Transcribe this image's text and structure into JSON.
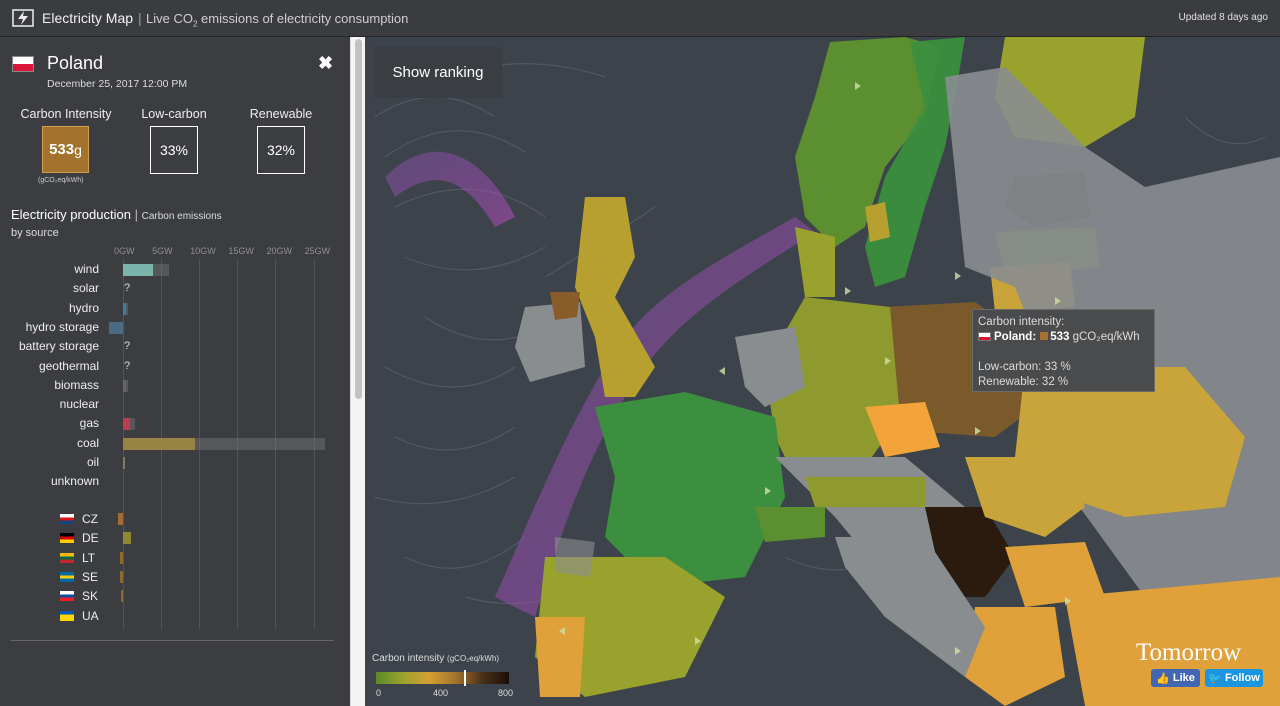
{
  "header": {
    "app_name": "Electricity Map",
    "separator": "|",
    "subtitle_prefix": "Live CO",
    "subtitle_sub": "2",
    "subtitle_suffix": " emissions of electricity consumption",
    "updated": "Updated 8 days ago"
  },
  "panel": {
    "country": "Poland",
    "datetime": "December 25, 2017 12:00 PM",
    "close_symbol": "✖",
    "carbon_intensity": {
      "label": "Carbon Intensity",
      "value": "533",
      "unit_suffix": "g",
      "unit_note": "(gCO₂eq/kWh)",
      "color": "#a3732e"
    },
    "low_carbon": {
      "label": "Low-carbon",
      "value": "33%"
    },
    "renewable": {
      "label": "Renewable",
      "value": "32%"
    },
    "production": {
      "title": "Electricity production",
      "separator": "|",
      "alt_tab": "Carbon emissions",
      "subtitle": "by source",
      "axis_ticks": [
        "0GW",
        "5GW",
        "10GW",
        "15GW",
        "20GW",
        "25GW"
      ],
      "axis_max_gw": 26.5,
      "sources": [
        {
          "label": "wind",
          "value_gw": 4.0,
          "capacity_gw": 6.0,
          "color": "#80bfb2",
          "unknown": false
        },
        {
          "label": "solar",
          "value_gw": null,
          "capacity_gw": null,
          "color": "#f2c94c",
          "unknown": true,
          "unknown_mark": "?"
        },
        {
          "label": "hydro",
          "value_gw": 0.35,
          "capacity_gw": 0.6,
          "color": "#3b7fb3",
          "unknown": false
        },
        {
          "label": "hydro storage",
          "value_gw": -1.8,
          "capacity_gw": 1.8,
          "color": "#3b7fb3",
          "unknown": false
        },
        {
          "label": "battery storage",
          "value_gw": null,
          "capacity_gw": null,
          "color": "#999999",
          "unknown": true,
          "unknown_mark": "?"
        },
        {
          "label": "geothermal",
          "value_gw": null,
          "capacity_gw": null,
          "color": "#999999",
          "unknown": true,
          "unknown_mark": "?"
        },
        {
          "label": "biomass",
          "value_gw": 0.4,
          "capacity_gw": 0.6,
          "color": "#666666",
          "unknown": false
        },
        {
          "label": "nuclear",
          "value_gw": 0,
          "capacity_gw": 0,
          "color": "#ae3b4f",
          "unknown": false
        },
        {
          "label": "gas",
          "value_gw": 0.9,
          "capacity_gw": 1.6,
          "color": "#c43a4e",
          "unknown": false
        },
        {
          "label": "coal",
          "value_gw": 9.5,
          "capacity_gw": 26.5,
          "color": "#9f8a3f",
          "unknown": false
        },
        {
          "label": "oil",
          "value_gw": 0.25,
          "capacity_gw": 0.3,
          "color": "#867d66",
          "unknown": false
        },
        {
          "label": "unknown",
          "value_gw": 0,
          "capacity_gw": 0,
          "color": "#666666",
          "unknown": false
        }
      ],
      "exchanges": [
        {
          "code": "CZ",
          "value_gw": -0.6,
          "color": "#a36b30",
          "flag": [
            "#ffffff",
            "#d7141a",
            "#11457e"
          ]
        },
        {
          "code": "DE",
          "value_gw": 1.0,
          "color": "#8e8a30",
          "flag": [
            "#000000",
            "#dd0000",
            "#ffce00"
          ]
        },
        {
          "code": "LT",
          "value_gw": -0.4,
          "color": "#8d6a2a",
          "flag": [
            "#fdb913",
            "#006a44",
            "#c1272d"
          ]
        },
        {
          "code": "SE",
          "value_gw": -0.4,
          "color": "#8a6a30",
          "flag": [
            "#006aa7",
            "#fecc00",
            "#006aa7"
          ]
        },
        {
          "code": "SK",
          "value_gw": -0.3,
          "color": "#8a6a30",
          "flag": [
            "#ffffff",
            "#0b4ea2",
            "#ee1c25"
          ]
        },
        {
          "code": "UA",
          "value_gw": 0.0,
          "color": "#8a6a30",
          "flag": [
            "#0057b7",
            "#ffd700",
            "#ffd700"
          ]
        }
      ]
    }
  },
  "map": {
    "show_ranking": "Show ranking",
    "tooltip": {
      "title": "Carbon intensity:",
      "country": "Poland",
      "value": "533",
      "unit": "gCO₂eq/kWh",
      "low_carbon": "Low-carbon: 33 %",
      "renewable": "Renewable: 32 %"
    },
    "legend": {
      "title": "Carbon intensity",
      "unit": "(gCO₂eq/kWh)",
      "ticks": [
        "0",
        "400",
        "800"
      ],
      "marker_value": 533
    },
    "brand": "Tomorrow",
    "like_label": "Like",
    "follow_label": "Follow"
  }
}
